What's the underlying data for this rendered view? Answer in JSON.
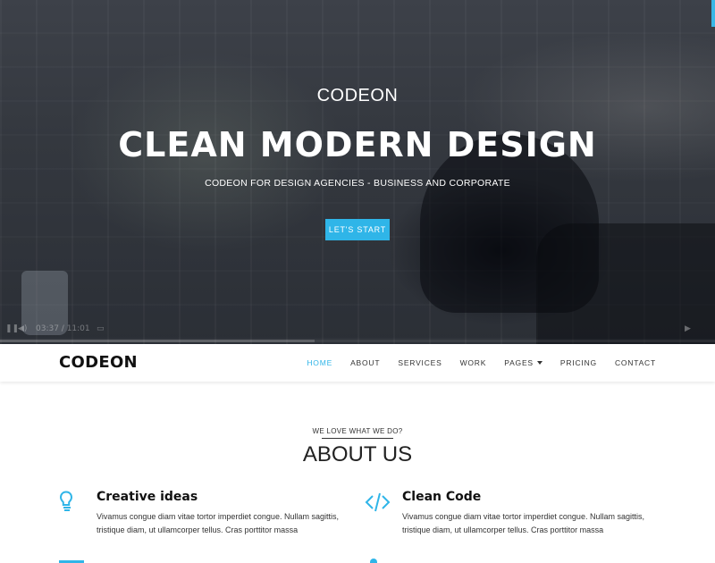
{
  "hero": {
    "brand": "CODEON",
    "title": "CLEAN MODERN DESIGN",
    "subtitle": "CODEON FOR DESIGN AGENCIES - BUSINESS AND CORPORATE",
    "cta_label": "LET'S START",
    "video": {
      "time": "03:37 / 11:01",
      "progress": 0.44
    }
  },
  "navbar": {
    "logo": "CODEON",
    "items": [
      {
        "label": "HOME",
        "active": true
      },
      {
        "label": "ABOUT"
      },
      {
        "label": "SERVICES"
      },
      {
        "label": "WORK"
      },
      {
        "label": "PAGES",
        "dropdown": true
      },
      {
        "label": "PRICING"
      },
      {
        "label": "CONTACT"
      }
    ]
  },
  "about": {
    "eyebrow": "WE LOVE WHAT WE DO?",
    "title": "ABOUT US",
    "features": [
      {
        "icon": "lightbulb-icon",
        "title": "Creative ideas",
        "text": "Vivamus congue diam vitae tortor imperdiet congue. Nullam sagittis, tristique diam, ut ullamcorper tellus. Cras porttitor massa"
      },
      {
        "icon": "code-icon",
        "title": "Clean Code",
        "text": "Vivamus congue diam vitae tortor imperdiet congue. Nullam sagittis, tristique diam, ut ullamcorper tellus. Cras porttitor massa"
      }
    ]
  },
  "colors": {
    "accent": "#2fb5e8",
    "hero_overlay": "#34383f",
    "text_dark": "#111111"
  }
}
